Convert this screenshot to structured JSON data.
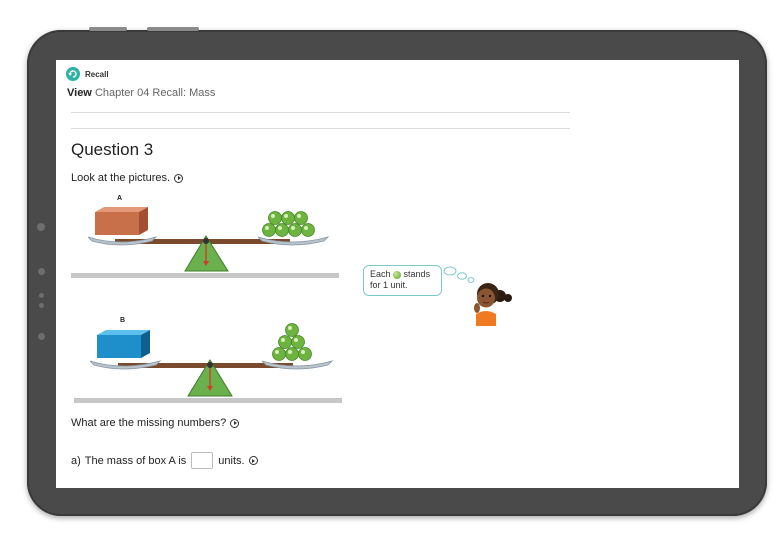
{
  "app": {
    "brand": "Recall"
  },
  "breadcrumb": {
    "view": "View",
    "path": "Chapter 04 Recall: Mass"
  },
  "question": {
    "title": "Question 3",
    "instruction": "Look at the pictures.",
    "figures": [
      {
        "label": "A",
        "box_color": "#c8704a",
        "marbles": 7
      },
      {
        "label": "B",
        "box_color": "#1f8fcc",
        "marbles": 6
      }
    ],
    "hint": {
      "before": "Each",
      "after": "stands",
      "line2": "for 1 unit."
    },
    "ask": "What are the missing numbers?",
    "part_a": {
      "prefix": "a)",
      "before": "The mass of box A is",
      "value": "",
      "after": "units."
    }
  },
  "colors": {
    "accent": "#2bb3a3",
    "bezel": "#4a4a4a",
    "marble": "#6db33f",
    "bubble_border": "#7cc9c9"
  }
}
